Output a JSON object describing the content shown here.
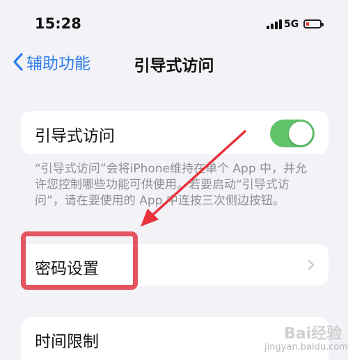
{
  "status_bar": {
    "time": "15:28",
    "network": "5G",
    "battery_color": "#e53935"
  },
  "nav": {
    "back_label": "辅助功能",
    "title": "引导式访问",
    "accent_color": "#2b7de9"
  },
  "guided_access": {
    "label": "引导式访问",
    "toggle_on": true,
    "toggle_color": "#5fc36a"
  },
  "description": "“引导式访问”会将iPhone维持在单个 App 中，并允许您控制哪些功能可供使用。若要启动“引导式访问”，请在要使用的 App 中连按三次侧边按钮。",
  "passcode_settings": {
    "label": "密码设置"
  },
  "time_limits": {
    "label": "时间限制"
  },
  "annotation": {
    "color": "#e45560"
  },
  "watermark": {
    "logo": "Bai经验",
    "url": "jingyan.baidu.com"
  }
}
